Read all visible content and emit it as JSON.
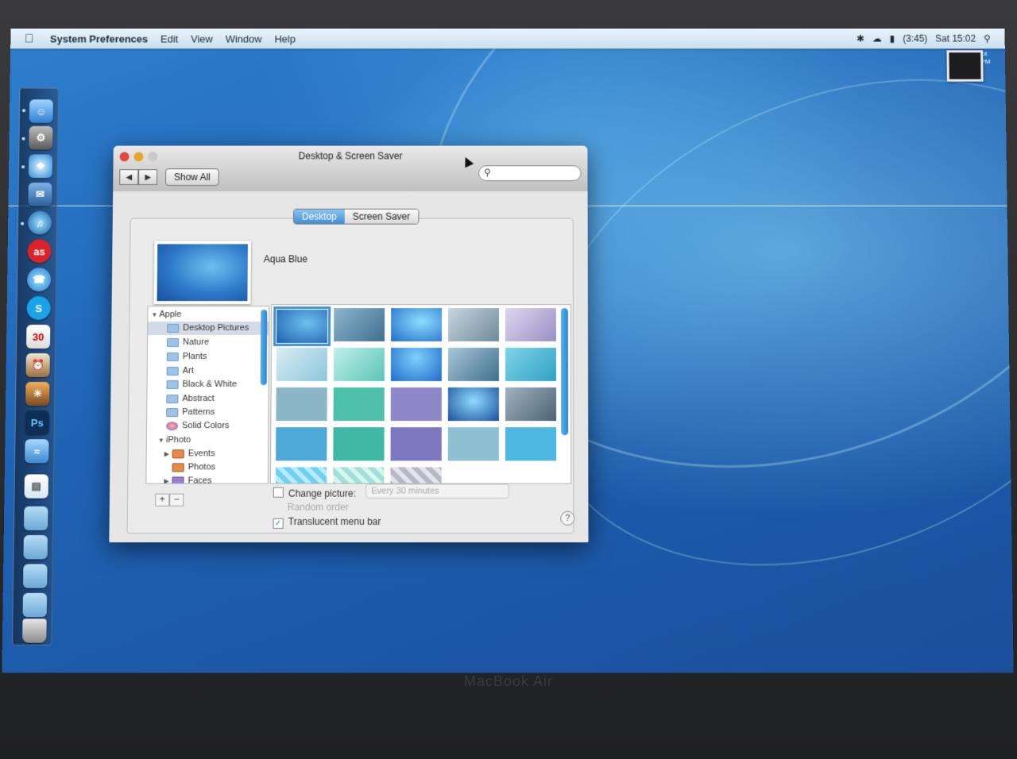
{
  "menubar": {
    "app_name": "System Preferences",
    "menus": [
      "Edit",
      "View",
      "Window",
      "Help"
    ],
    "battery": "(3:45)",
    "clock": "Sat 15:02"
  },
  "desktop_file": {
    "label": "Screen shot 2010-...46 PM"
  },
  "window": {
    "title": "Desktop & Screen Saver",
    "show_all_label": "Show All",
    "tabs": [
      "Desktop",
      "Screen Saver"
    ],
    "selected_picture_name": "Aqua Blue",
    "sources": [
      {
        "label": "Apple",
        "type": "group"
      },
      {
        "label": "Desktop Pictures",
        "type": "folder",
        "selected": true
      },
      {
        "label": "Nature",
        "type": "folder"
      },
      {
        "label": "Plants",
        "type": "folder"
      },
      {
        "label": "Art",
        "type": "folder"
      },
      {
        "label": "Black & White",
        "type": "folder"
      },
      {
        "label": "Abstract",
        "type": "folder"
      },
      {
        "label": "Patterns",
        "type": "folder"
      },
      {
        "label": "Solid Colors",
        "type": "folder"
      },
      {
        "label": "iPhoto",
        "type": "group"
      },
      {
        "label": "Events",
        "type": "folder"
      },
      {
        "label": "Photos",
        "type": "folder"
      },
      {
        "label": "Faces",
        "type": "folder"
      }
    ],
    "change_picture_label": "Change picture:",
    "change_interval": "Every 30 minutes",
    "random_order_label": "Random order",
    "translucent_label": "Translucent menu bar",
    "help_label": "?"
  },
  "brand": "MacBook Air"
}
